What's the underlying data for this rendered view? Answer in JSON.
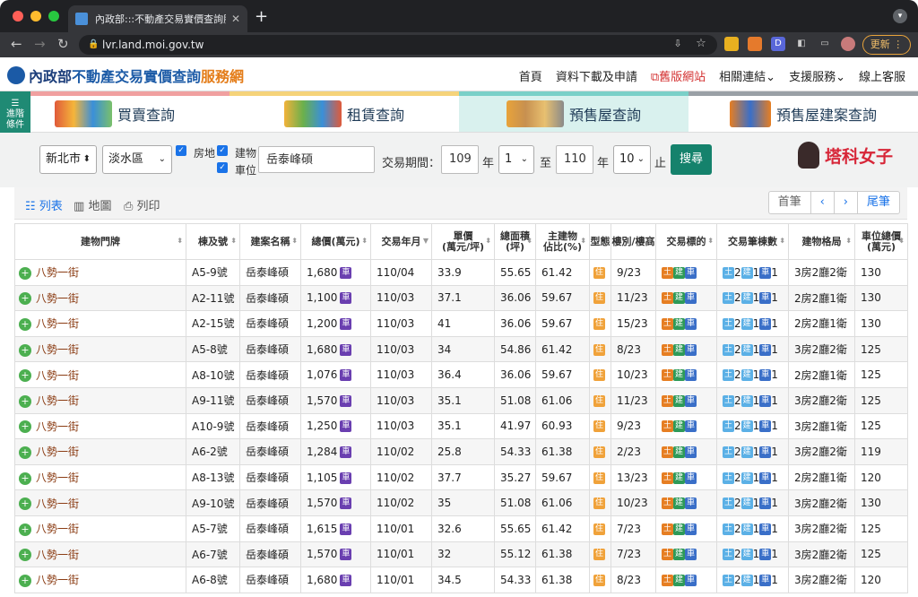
{
  "browser": {
    "tab_title": "內政部:::不動產交易實價查詢服務",
    "url": "lvr.land.moi.gov.tw",
    "update_label": "更新"
  },
  "site": {
    "logo_part1": "內政部",
    "logo_part2": "不動產交易實價查詢",
    "logo_part3": "服務網",
    "nav": [
      "首頁",
      "資料下載及申請",
      "舊版網站",
      "相關連結",
      "支援服務",
      "線上客服"
    ]
  },
  "categories": [
    "買賣查詢",
    "租賃查詢",
    "預售屋查詢",
    "預售屋建案查詢"
  ],
  "advanced_label": "進階條件",
  "filter": {
    "city": "新北市",
    "district": "淡水區",
    "cb_land": "房地",
    "cb_building": "建物",
    "cb_parking": "車位",
    "keyword": "岳泰峰碩",
    "period_label": "交易期間：",
    "from_year": "109",
    "year_unit": "年",
    "from_month": "1",
    "to_label": "至",
    "to_year": "110",
    "to_month": "10",
    "end_label": "止",
    "search_button": "搜尋"
  },
  "brand": "塔科女子",
  "view": {
    "list": "列表",
    "map": "地圖",
    "print": "列印",
    "pager": [
      "首筆",
      "‹",
      "›",
      "尾筆"
    ]
  },
  "table": {
    "headers": [
      "建物門牌",
      "棟及號",
      "建案名稱",
      "總價(萬元)",
      "交易年月",
      "單價\n(萬元/坪)",
      "總面積\n(坪)",
      "主建物\n佔比(%)",
      "型態",
      "樓別/樓高",
      "交易標的",
      "交易筆棟數",
      "建物格局",
      "車位總價\n(萬元)"
    ],
    "badges": {
      "car": "車",
      "house": "住",
      "land": "土",
      "building": "建"
    },
    "rows": [
      {
        "addr": "八勢一街",
        "unit": "A5-9號",
        "name": "岳泰峰碩",
        "total": "1,680",
        "date": "110/04",
        "price": "33.9",
        "area": "55.65",
        "ratio": "61.42",
        "floor": "9/23",
        "cnt": [
          "2",
          "1",
          "1"
        ],
        "layout": "3房2廳2衛",
        "park": "130"
      },
      {
        "addr": "八勢一街",
        "unit": "A2-11號",
        "name": "岳泰峰碩",
        "total": "1,100",
        "date": "110/03",
        "price": "37.1",
        "area": "36.06",
        "ratio": "59.67",
        "floor": "11/23",
        "cnt": [
          "2",
          "1",
          "1"
        ],
        "layout": "2房2廳1衛",
        "park": "130"
      },
      {
        "addr": "八勢一街",
        "unit": "A2-15號",
        "name": "岳泰峰碩",
        "total": "1,200",
        "date": "110/03",
        "price": "41",
        "area": "36.06",
        "ratio": "59.67",
        "floor": "15/23",
        "cnt": [
          "2",
          "1",
          "1"
        ],
        "layout": "2房2廳1衛",
        "park": "130"
      },
      {
        "addr": "八勢一街",
        "unit": "A5-8號",
        "name": "岳泰峰碩",
        "total": "1,680",
        "date": "110/03",
        "price": "34",
        "area": "54.86",
        "ratio": "61.42",
        "floor": "8/23",
        "cnt": [
          "2",
          "1",
          "1"
        ],
        "layout": "3房2廳2衛",
        "park": "125"
      },
      {
        "addr": "八勢一街",
        "unit": "A8-10號",
        "name": "岳泰峰碩",
        "total": "1,076",
        "date": "110/03",
        "price": "36.4",
        "area": "36.06",
        "ratio": "59.67",
        "floor": "10/23",
        "cnt": [
          "2",
          "1",
          "1"
        ],
        "layout": "2房2廳1衛",
        "park": "125"
      },
      {
        "addr": "八勢一街",
        "unit": "A9-11號",
        "name": "岳泰峰碩",
        "total": "1,570",
        "date": "110/03",
        "price": "35.1",
        "area": "51.08",
        "ratio": "61.06",
        "floor": "11/23",
        "cnt": [
          "2",
          "1",
          "1"
        ],
        "layout": "3房2廳2衛",
        "park": "125"
      },
      {
        "addr": "八勢一街",
        "unit": "A10-9號",
        "name": "岳泰峰碩",
        "total": "1,250",
        "date": "110/03",
        "price": "35.1",
        "area": "41.97",
        "ratio": "60.93",
        "floor": "9/23",
        "cnt": [
          "2",
          "1",
          "1"
        ],
        "layout": "3房2廳1衛",
        "park": "125"
      },
      {
        "addr": "八勢一街",
        "unit": "A6-2號",
        "name": "岳泰峰碩",
        "total": "1,284",
        "date": "110/02",
        "price": "25.8",
        "area": "54.33",
        "ratio": "61.38",
        "floor": "2/23",
        "cnt": [
          "2",
          "1",
          "1"
        ],
        "layout": "3房2廳2衛",
        "park": "119"
      },
      {
        "addr": "八勢一街",
        "unit": "A8-13號",
        "name": "岳泰峰碩",
        "total": "1,105",
        "date": "110/02",
        "price": "37.7",
        "area": "35.27",
        "ratio": "59.67",
        "floor": "13/23",
        "cnt": [
          "2",
          "1",
          "1"
        ],
        "layout": "2房2廳1衛",
        "park": "120"
      },
      {
        "addr": "八勢一街",
        "unit": "A9-10號",
        "name": "岳泰峰碩",
        "total": "1,570",
        "date": "110/02",
        "price": "35",
        "area": "51.08",
        "ratio": "61.06",
        "floor": "10/23",
        "cnt": [
          "2",
          "1",
          "1"
        ],
        "layout": "3房2廳2衛",
        "park": "130"
      },
      {
        "addr": "八勢一街",
        "unit": "A5-7號",
        "name": "岳泰峰碩",
        "total": "1,615",
        "date": "110/01",
        "price": "32.6",
        "area": "55.65",
        "ratio": "61.42",
        "floor": "7/23",
        "cnt": [
          "2",
          "1",
          "1"
        ],
        "layout": "3房2廳2衛",
        "park": "125"
      },
      {
        "addr": "八勢一街",
        "unit": "A6-7號",
        "name": "岳泰峰碩",
        "total": "1,570",
        "date": "110/01",
        "price": "32",
        "area": "55.12",
        "ratio": "61.38",
        "floor": "7/23",
        "cnt": [
          "2",
          "1",
          "1"
        ],
        "layout": "3房2廳2衛",
        "park": "125"
      },
      {
        "addr": "八勢一街",
        "unit": "A6-8號",
        "name": "岳泰峰碩",
        "total": "1,680",
        "date": "110/01",
        "price": "34.5",
        "area": "54.33",
        "ratio": "61.38",
        "floor": "8/23",
        "cnt": [
          "2",
          "1",
          "1"
        ],
        "layout": "3房2廳2衛",
        "park": "120"
      }
    ]
  }
}
